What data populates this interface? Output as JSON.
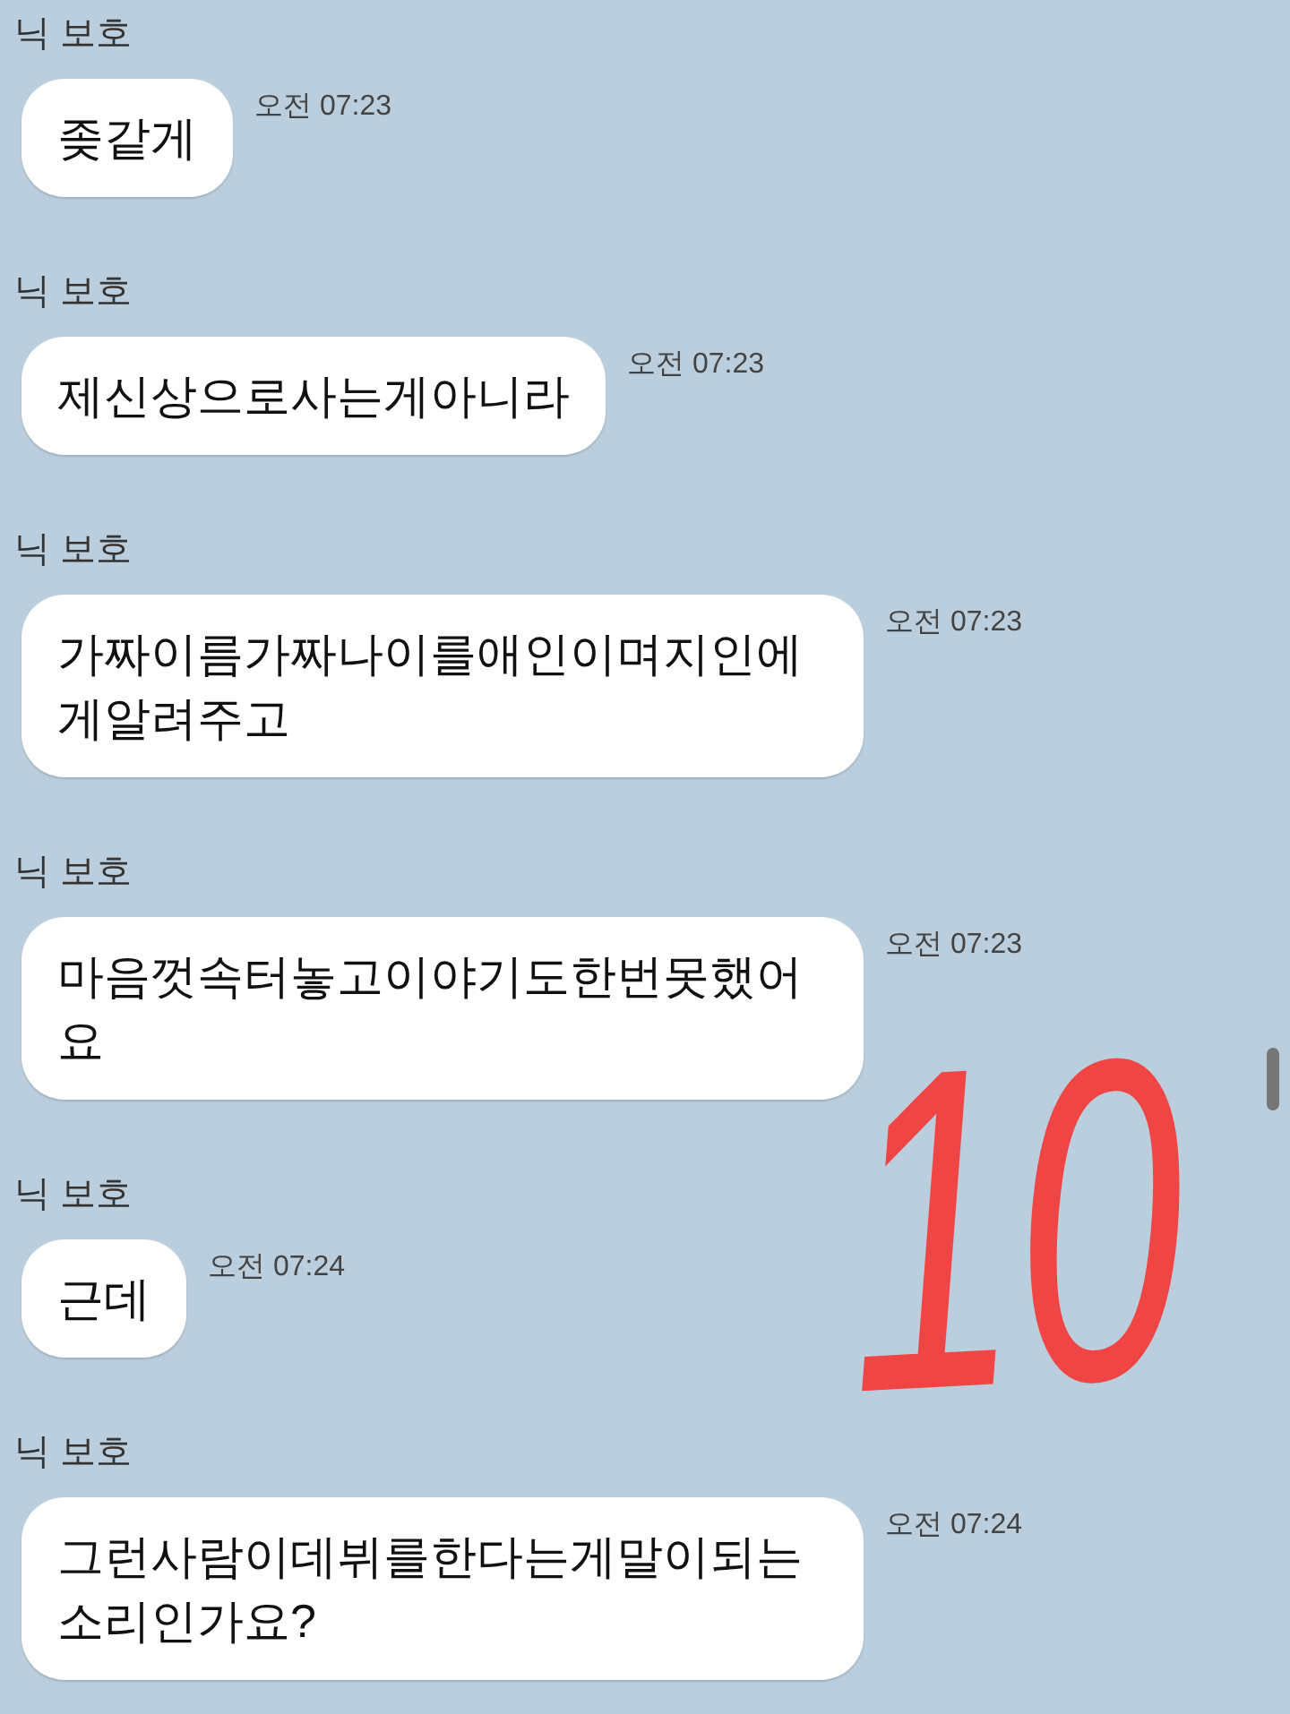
{
  "messages": [
    {
      "sender": "닉 보호",
      "text": "좆같게",
      "time": "오전 07:23"
    },
    {
      "sender": "닉 보호",
      "text": "제신상으로사는게아니라",
      "time": "오전 07:23"
    },
    {
      "sender": "닉 보호",
      "text": "가짜이름가짜나이를애인이며지인에게알려주고",
      "time": "오전 07:23"
    },
    {
      "sender": "닉 보호",
      "text": "마음껏속터놓고이야기도한번못했어요",
      "time": "오전 07:23"
    },
    {
      "sender": "닉 보호",
      "text": "근데",
      "time": "오전 07:24"
    },
    {
      "sender": "닉 보호",
      "text": "그런사람이데뷔를한다는게말이되는소리인가요?",
      "time": "오전 07:24"
    }
  ],
  "annotation": {
    "text": "10",
    "color": "#f04545"
  }
}
